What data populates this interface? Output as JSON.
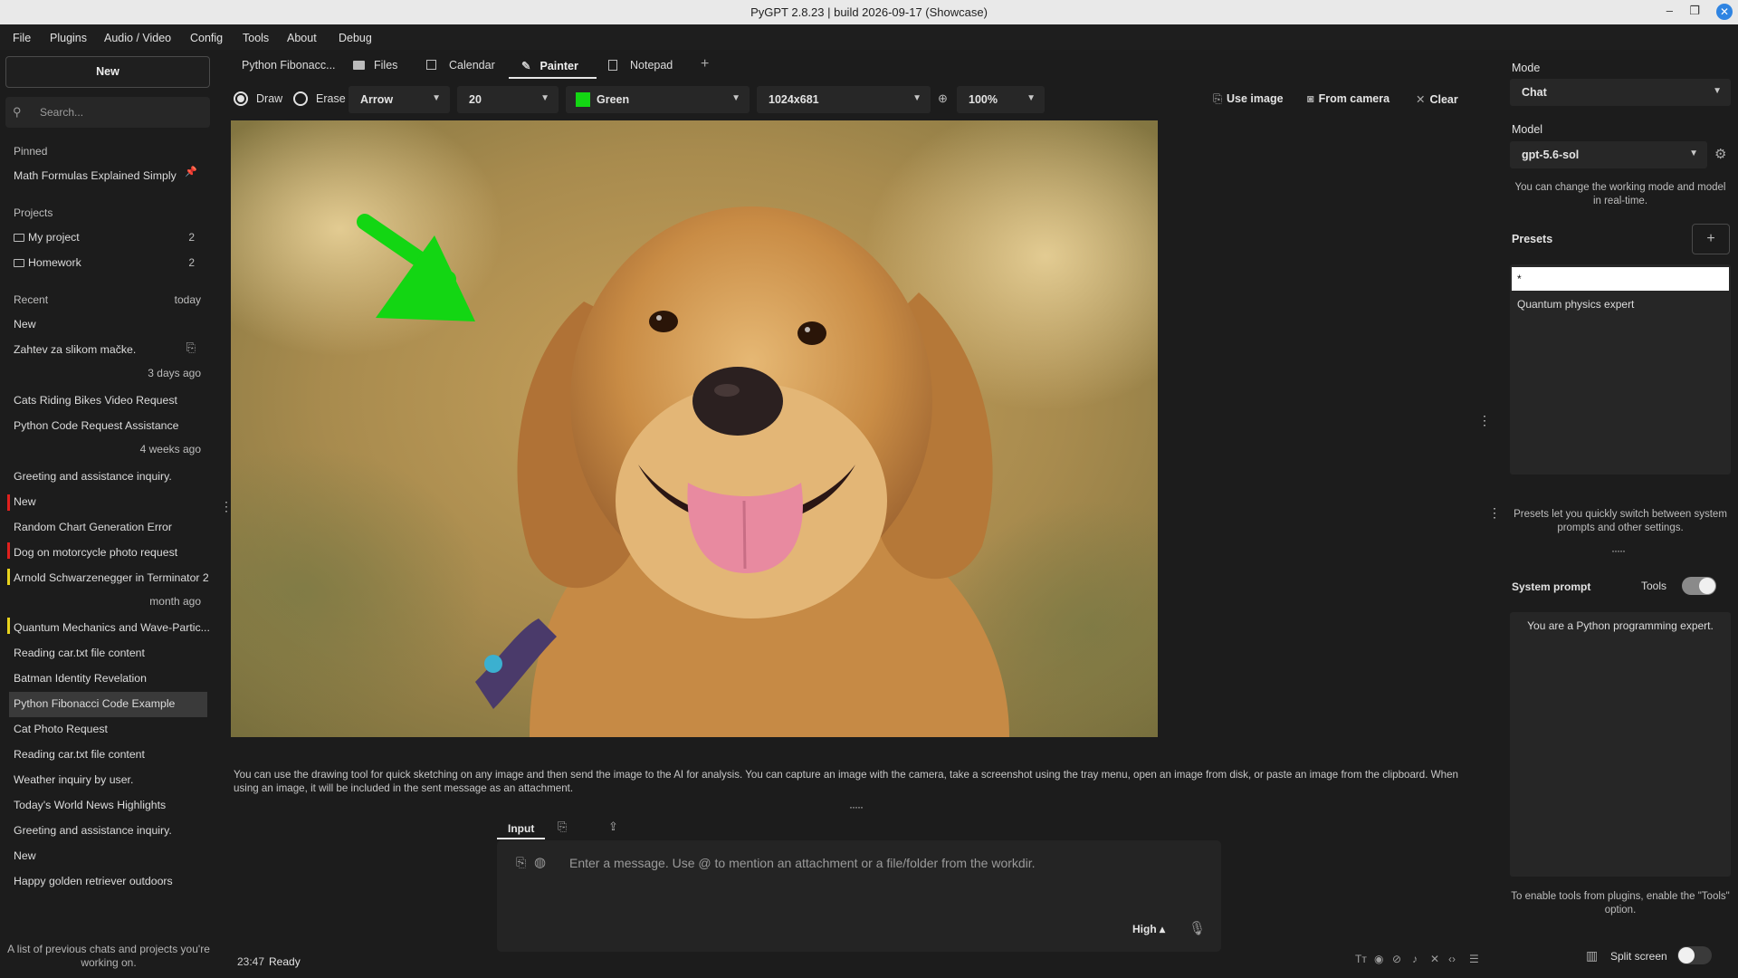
{
  "window": {
    "title": "PyGPT 2.8.23 | build 2026-09-17 (Showcase)",
    "min": "–",
    "max": "❐",
    "close": "✕"
  },
  "menu": [
    "File",
    "Plugins",
    "Audio / Video",
    "Config",
    "Tools",
    "About",
    "Debug"
  ],
  "sidebar": {
    "new_label": "New",
    "search_placeholder": "Search...",
    "pinned_header": "Pinned",
    "pinned": [
      "Math Formulas Explained Simply"
    ],
    "projects_header": "Projects",
    "projects": [
      {
        "name": "My project",
        "count": "2"
      },
      {
        "name": "Homework",
        "count": "2"
      }
    ],
    "recent_header": "Recent",
    "groups": {
      "today": "today",
      "days3": "3 days ago",
      "weeks4": "4 weeks ago",
      "month": "month ago"
    },
    "today_items": [
      "New",
      "Zahtev za slikom mačke."
    ],
    "days3_items": [
      "Cats Riding Bikes Video Request",
      "Python Code Request Assistance"
    ],
    "weeks4_items": [
      "Greeting and assistance inquiry.",
      "New",
      "Random Chart Generation Error",
      "Dog on motorcycle photo request",
      "Arnold Schwarzenegger in Terminator 2"
    ],
    "month_items": [
      "Quantum Mechanics and Wave-Partic...",
      "Reading car.txt file content",
      "Batman Identity Revelation",
      "Python Fibonacci Code Example",
      "Cat Photo Request",
      "Reading car.txt file content",
      "Weather inquiry by user.",
      "Today's World News Highlights",
      "Greeting and assistance inquiry.",
      "New",
      "Happy golden retriever outdoors"
    ],
    "footer": "A list of previous chats and projects you're working on.",
    "marker_colors": {
      "red": "#e0201d",
      "yellow": "#e8d31d"
    }
  },
  "tabs": [
    "Python Fibonacc...",
    "Files",
    "Calendar",
    "Painter",
    "Notepad",
    "+"
  ],
  "toolbar": {
    "draw": "Draw",
    "erase": "Erase",
    "brush": "Arrow",
    "size": "20",
    "color_name": "Green",
    "color_hex": "#13d613",
    "canvas_size": "1024x681",
    "zoom": "100%",
    "use_image": "Use image",
    "from_camera": "From camera",
    "clear": "Clear"
  },
  "canvas_hint": "You can use the drawing tool for quick sketching on any image and then send the image to the AI for analysis. You can capture an image with the camera, take a screenshot using the tray menu, open an image from disk, or paste an image from the clipboard. When using an image, it will be included in the sent message as an attachment.",
  "input": {
    "tab_label": "Input",
    "placeholder": "Enter a message. Use @ to mention an attachment or a file/folder from the workdir.",
    "quality": "High ▴"
  },
  "status": {
    "time": "23:47",
    "text": "Ready"
  },
  "right": {
    "mode_label": "Mode",
    "mode_value": "Chat",
    "model_label": "Model",
    "model_value": "gpt-5.6-sol",
    "model_hint": "You can change the working mode and model in real-time.",
    "presets_label": "Presets",
    "presets": [
      "*",
      "Quantum physics expert"
    ],
    "presets_hint": "Presets let you quickly switch between system prompts and other settings.",
    "system_prompt_label": "System prompt",
    "tools_label": "Tools",
    "system_prompt": "You are a Python programming expert.",
    "tools_hint": "To enable tools from plugins, enable the \"Tools\" option.",
    "split_screen": "Split screen"
  }
}
